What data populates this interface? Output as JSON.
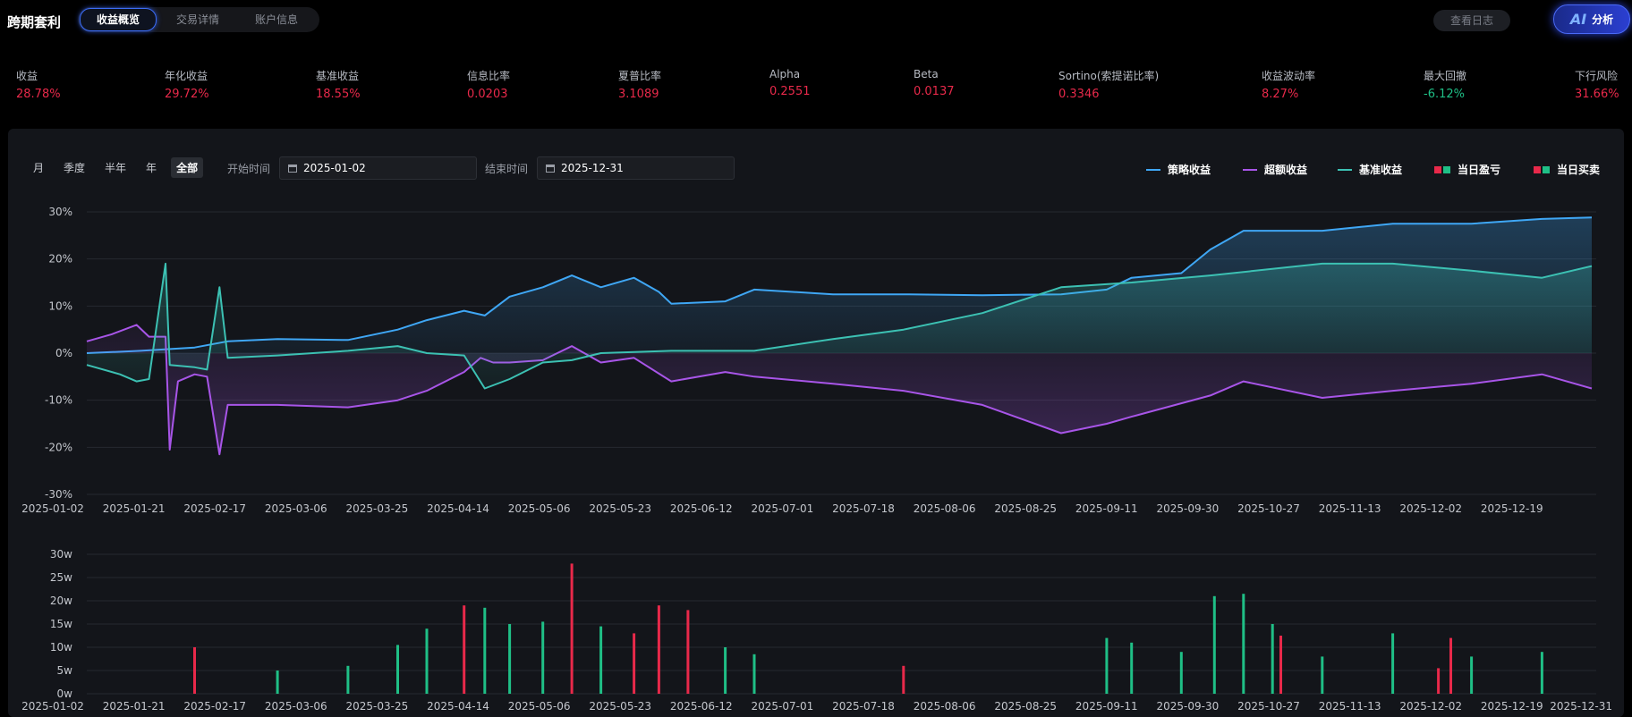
{
  "app": {
    "title": "跨期套利"
  },
  "tabs": [
    {
      "label": "收益概览",
      "active": true
    },
    {
      "label": "交易详情",
      "active": false
    },
    {
      "label": "账户信息",
      "active": false
    }
  ],
  "header": {
    "log_button": "查看日志",
    "ai_logo": "AI",
    "ai_button": "分析"
  },
  "metrics": [
    {
      "label": "收益",
      "value": "28.78%",
      "tone": "red"
    },
    {
      "label": "年化收益",
      "value": "29.72%",
      "tone": "red"
    },
    {
      "label": "基准收益",
      "value": "18.55%",
      "tone": "red"
    },
    {
      "label": "信息比率",
      "value": "0.0203",
      "tone": "red"
    },
    {
      "label": "夏普比率",
      "value": "3.1089",
      "tone": "red"
    },
    {
      "label": "Alpha",
      "value": "0.2551",
      "tone": "red"
    },
    {
      "label": "Beta",
      "value": "0.0137",
      "tone": "red"
    },
    {
      "label": "Sortino(索提诺比率)",
      "value": "0.3346",
      "tone": "red"
    },
    {
      "label": "收益波动率",
      "value": "8.27%",
      "tone": "red"
    },
    {
      "label": "最大回撤",
      "value": "-6.12%",
      "tone": "green"
    },
    {
      "label": "下行风险",
      "value": "31.66%",
      "tone": "red"
    }
  ],
  "filters": {
    "periods": [
      {
        "label": "月",
        "active": false
      },
      {
        "label": "季度",
        "active": false
      },
      {
        "label": "半年",
        "active": false
      },
      {
        "label": "年",
        "active": false
      },
      {
        "label": "全部",
        "active": true
      }
    ],
    "start_label": "开始时间",
    "start_value": "2025-01-02",
    "end_label": "结束时间",
    "end_value": "2025-12-31"
  },
  "legend": [
    {
      "name": "策略收益",
      "kind": "line",
      "color": "#3fa7f5"
    },
    {
      "name": "超额收益",
      "kind": "line",
      "color": "#a855e8"
    },
    {
      "name": "基准收益",
      "kind": "line",
      "color": "#3cc1b3"
    },
    {
      "name": "当日盈亏",
      "kind": "squares",
      "colors": [
        "#e8294a",
        "#1fbf86"
      ]
    },
    {
      "name": "当日买卖",
      "kind": "squares",
      "colors": [
        "#e8294a",
        "#1fbf86"
      ]
    }
  ],
  "colors": {
    "strategy": "#3fa7f5",
    "excess": "#a855e8",
    "benchmark": "#3cc1b3",
    "buy": "#e8294a",
    "sell": "#1fbf86"
  },
  "chart_data": [
    {
      "type": "line",
      "x_ticks": [
        "2025-01-02",
        "2025-01-21",
        "2025-02-17",
        "2025-03-06",
        "2025-03-25",
        "2025-04-14",
        "2025-05-06",
        "2025-05-23",
        "2025-06-12",
        "2025-07-01",
        "2025-07-18",
        "2025-08-06",
        "2025-08-25",
        "2025-09-11",
        "2025-09-30",
        "2025-10-27",
        "2025-11-13",
        "2025-12-02",
        "2025-12-19"
      ],
      "y_ticks": [
        "30%",
        "20%",
        "10%",
        "0%",
        "-10%",
        "-20%",
        "-30%"
      ],
      "ylim": [
        -30,
        30
      ],
      "x_range": [
        "2025-01-02",
        "2025-12-31"
      ],
      "series": [
        {
          "name": "策略收益",
          "points": [
            [
              "2025-01-02",
              0
            ],
            [
              "2025-01-15",
              0.5
            ],
            [
              "2025-01-28",
              1.2
            ],
            [
              "2025-02-05",
              2.5
            ],
            [
              "2025-02-17",
              3
            ],
            [
              "2025-03-06",
              2.8
            ],
            [
              "2025-03-18",
              5
            ],
            [
              "2025-03-25",
              7
            ],
            [
              "2025-04-03",
              9
            ],
            [
              "2025-04-08",
              8
            ],
            [
              "2025-04-14",
              12
            ],
            [
              "2025-04-22",
              14
            ],
            [
              "2025-04-29",
              16.5
            ],
            [
              "2025-05-06",
              14
            ],
            [
              "2025-05-14",
              16
            ],
            [
              "2025-05-20",
              13
            ],
            [
              "2025-05-23",
              10.5
            ],
            [
              "2025-06-05",
              11
            ],
            [
              "2025-06-12",
              13.5
            ],
            [
              "2025-07-01",
              12.5
            ],
            [
              "2025-07-18",
              12.5
            ],
            [
              "2025-08-06",
              12.3
            ],
            [
              "2025-08-25",
              12.5
            ],
            [
              "2025-09-05",
              13.5
            ],
            [
              "2025-09-11",
              16
            ],
            [
              "2025-09-23",
              17
            ],
            [
              "2025-09-30",
              22
            ],
            [
              "2025-10-08",
              26
            ],
            [
              "2025-10-27",
              26
            ],
            [
              "2025-11-13",
              27.5
            ],
            [
              "2025-12-02",
              27.5
            ],
            [
              "2025-12-19",
              28.5
            ],
            [
              "2025-12-31",
              28.8
            ]
          ]
        },
        {
          "name": "超额收益",
          "points": [
            [
              "2025-01-02",
              2.5
            ],
            [
              "2025-01-08",
              4
            ],
            [
              "2025-01-14",
              6
            ],
            [
              "2025-01-17",
              3.5
            ],
            [
              "2025-01-21",
              3.5
            ],
            [
              "2025-01-22",
              -20.5
            ],
            [
              "2025-01-24",
              -6
            ],
            [
              "2025-01-28",
              -4.5
            ],
            [
              "2025-01-31",
              -5
            ],
            [
              "2025-02-03",
              -21.5
            ],
            [
              "2025-02-05",
              -11
            ],
            [
              "2025-02-17",
              -11
            ],
            [
              "2025-03-06",
              -11.5
            ],
            [
              "2025-03-18",
              -10
            ],
            [
              "2025-03-25",
              -8
            ],
            [
              "2025-04-03",
              -4
            ],
            [
              "2025-04-07",
              -1
            ],
            [
              "2025-04-10",
              -2
            ],
            [
              "2025-04-14",
              -2
            ],
            [
              "2025-04-22",
              -1.5
            ],
            [
              "2025-04-29",
              1.5
            ],
            [
              "2025-05-06",
              -2
            ],
            [
              "2025-05-14",
              -1
            ],
            [
              "2025-05-23",
              -6
            ],
            [
              "2025-06-05",
              -4
            ],
            [
              "2025-06-12",
              -5
            ],
            [
              "2025-07-01",
              -6.5
            ],
            [
              "2025-07-18",
              -8
            ],
            [
              "2025-08-06",
              -11
            ],
            [
              "2025-08-25",
              -17
            ],
            [
              "2025-09-05",
              -15
            ],
            [
              "2025-09-11",
              -13.5
            ],
            [
              "2025-09-30",
              -9
            ],
            [
              "2025-10-08",
              -6
            ],
            [
              "2025-10-27",
              -9.5
            ],
            [
              "2025-11-13",
              -8
            ],
            [
              "2025-12-02",
              -6.5
            ],
            [
              "2025-12-19",
              -4.5
            ],
            [
              "2025-12-31",
              -7.5
            ]
          ]
        },
        {
          "name": "基准收益",
          "points": [
            [
              "2025-01-02",
              -2.5
            ],
            [
              "2025-01-10",
              -4.5
            ],
            [
              "2025-01-14",
              -6
            ],
            [
              "2025-01-17",
              -5.5
            ],
            [
              "2025-01-21",
              19
            ],
            [
              "2025-01-22",
              -2.5
            ],
            [
              "2025-01-28",
              -3
            ],
            [
              "2025-01-31",
              -3.5
            ],
            [
              "2025-02-03",
              14
            ],
            [
              "2025-02-05",
              -1
            ],
            [
              "2025-02-17",
              -0.5
            ],
            [
              "2025-03-06",
              0.5
            ],
            [
              "2025-03-18",
              1.5
            ],
            [
              "2025-03-25",
              0
            ],
            [
              "2025-04-03",
              -0.5
            ],
            [
              "2025-04-08",
              -7.5
            ],
            [
              "2025-04-14",
              -5.5
            ],
            [
              "2025-04-22",
              -2
            ],
            [
              "2025-04-29",
              -1.5
            ],
            [
              "2025-05-06",
              0
            ],
            [
              "2025-05-23",
              0.5
            ],
            [
              "2025-06-12",
              0.5
            ],
            [
              "2025-07-01",
              3
            ],
            [
              "2025-07-18",
              5
            ],
            [
              "2025-08-06",
              8.5
            ],
            [
              "2025-08-25",
              14
            ],
            [
              "2025-09-11",
              15
            ],
            [
              "2025-09-30",
              16.5
            ],
            [
              "2025-10-27",
              19
            ],
            [
              "2025-11-13",
              19
            ],
            [
              "2025-12-02",
              17.5
            ],
            [
              "2025-12-19",
              16
            ],
            [
              "2025-12-31",
              18.5
            ]
          ]
        }
      ]
    },
    {
      "type": "bar",
      "y_ticks": [
        "30w",
        "25w",
        "20w",
        "15w",
        "10w",
        "5w",
        "0w"
      ],
      "ylim": [
        0,
        30
      ],
      "unit": "w",
      "series": [
        {
          "name": "买入",
          "points": [
            [
              "2025-01-28",
              10
            ],
            [
              "2025-04-03",
              19
            ],
            [
              "2025-04-29",
              28
            ],
            [
              "2025-05-14",
              13
            ],
            [
              "2025-05-20",
              19
            ],
            [
              "2025-05-27",
              18
            ],
            [
              "2025-07-18",
              6
            ],
            [
              "2025-10-17",
              12.5
            ],
            [
              "2025-11-24",
              5.5
            ],
            [
              "2025-11-27",
              12
            ]
          ]
        },
        {
          "name": "卖出",
          "points": [
            [
              "2025-02-17",
              5
            ],
            [
              "2025-03-06",
              6
            ],
            [
              "2025-03-18",
              10.5
            ],
            [
              "2025-03-25",
              14
            ],
            [
              "2025-04-08",
              18.5
            ],
            [
              "2025-04-14",
              15
            ],
            [
              "2025-04-22",
              15.5
            ],
            [
              "2025-05-06",
              14.5
            ],
            [
              "2025-06-05",
              10
            ],
            [
              "2025-06-12",
              8.5
            ],
            [
              "2025-09-05",
              12
            ],
            [
              "2025-09-11",
              11
            ],
            [
              "2025-09-23",
              9
            ],
            [
              "2025-10-01",
              21
            ],
            [
              "2025-10-08",
              21.5
            ],
            [
              "2025-10-15",
              15
            ],
            [
              "2025-10-27",
              8
            ],
            [
              "2025-11-13",
              13
            ],
            [
              "2025-12-02",
              8
            ],
            [
              "2025-12-19",
              9
            ]
          ]
        }
      ]
    }
  ]
}
